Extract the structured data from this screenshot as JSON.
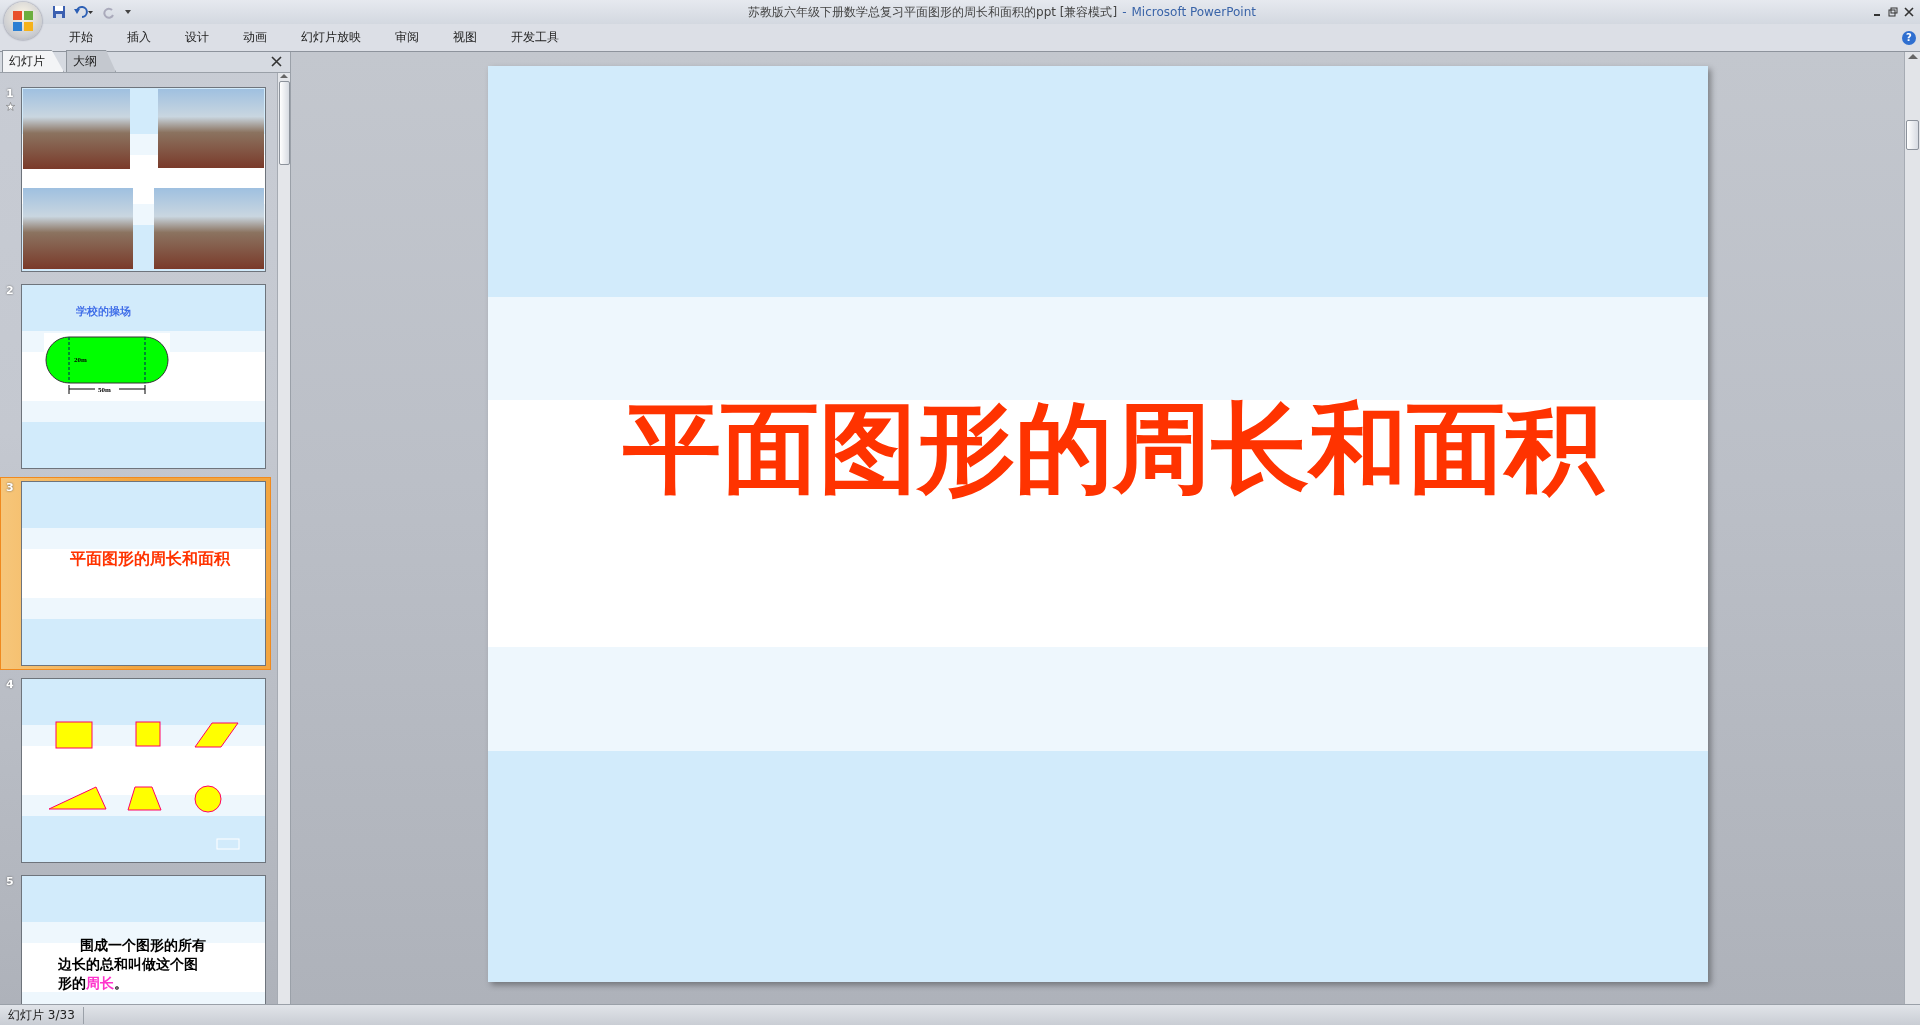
{
  "title_bar": {
    "title": "苏教版六年级下册数学总复习平面图形的周长和面积的ppt [兼容模式]",
    "separator": "-",
    "app": "Microsoft PowerPoint"
  },
  "ribbon_tabs": [
    {
      "label": "开始"
    },
    {
      "label": "插入"
    },
    {
      "label": "设计"
    },
    {
      "label": "动画"
    },
    {
      "label": "幻灯片放映"
    },
    {
      "label": "审阅"
    },
    {
      "label": "视图"
    },
    {
      "label": "开发工具"
    }
  ],
  "help": "?",
  "panel_tabs": [
    {
      "label": "幻灯片",
      "selected": true
    },
    {
      "label": "大纲",
      "selected": false
    }
  ],
  "slides": [
    {
      "number": "1",
      "kind": "photos",
      "selected": false,
      "animated": true
    },
    {
      "number": "2",
      "kind": "track",
      "selected": false,
      "animated": false,
      "title": "学校的操场",
      "height_label": "20m",
      "width_label": "50m"
    },
    {
      "number": "3",
      "kind": "title",
      "selected": true,
      "animated": false,
      "title": "平面图形的周长和面积"
    },
    {
      "number": "4",
      "kind": "shapes",
      "selected": false,
      "animated": false
    },
    {
      "number": "5",
      "kind": "text",
      "selected": false,
      "animated": false,
      "text": "围成一个图形的所有边长的总和叫做这个图形的",
      "highlight": "周长",
      "end": "。"
    }
  ],
  "main_slide": {
    "title": "平面图形的周长和面积"
  },
  "status_bar": {
    "text": "幻灯片 3/33"
  }
}
